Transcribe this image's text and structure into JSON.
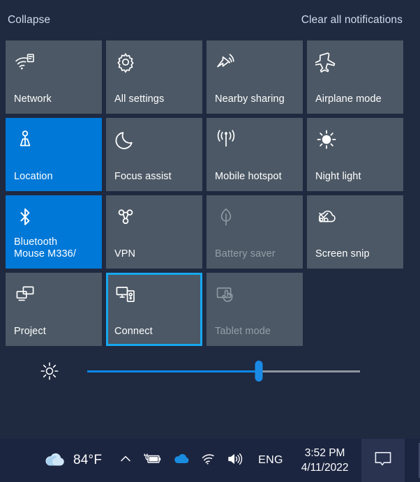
{
  "panel": {
    "background_color": "#1f2940",
    "tile_color": "#4c5865",
    "active_color": "#0078d7",
    "focus_color": "#16a8f0"
  },
  "header": {
    "collapse_label": "Collapse",
    "clear_all_label": "Clear all notifications"
  },
  "tiles": [
    {
      "label": "Network",
      "icon": "network-wifi-icon",
      "state": "normal"
    },
    {
      "label": "All settings",
      "icon": "gear-icon",
      "state": "normal"
    },
    {
      "label": "Nearby sharing",
      "icon": "nearby-sharing-icon",
      "state": "normal"
    },
    {
      "label": "Airplane mode",
      "icon": "airplane-icon",
      "state": "normal"
    },
    {
      "label": "Location",
      "icon": "location-icon",
      "state": "active"
    },
    {
      "label": "Focus assist",
      "icon": "moon-icon",
      "state": "normal"
    },
    {
      "label": "Mobile hotspot",
      "icon": "hotspot-icon",
      "state": "normal"
    },
    {
      "label": "Night light",
      "icon": "sun-icon",
      "state": "normal"
    },
    {
      "label": "Bluetooth\nMouse M336/",
      "icon": "bluetooth-icon",
      "state": "active"
    },
    {
      "label": "VPN",
      "icon": "vpn-icon",
      "state": "normal"
    },
    {
      "label": "Battery saver",
      "icon": "leaf-icon",
      "state": "disabled"
    },
    {
      "label": "Screen snip",
      "icon": "scissors-cloud-icon",
      "state": "normal"
    },
    {
      "label": "Project",
      "icon": "project-screen-icon",
      "state": "normal"
    },
    {
      "label": "Connect",
      "icon": "connect-device-icon",
      "state": "focused"
    },
    {
      "label": "Tablet mode",
      "icon": "tablet-touch-icon",
      "state": "disabled"
    }
  ],
  "brightness": {
    "icon": "brightness-sun-icon",
    "percent": 63
  },
  "taskbar": {
    "weather": {
      "icon": "weather-cloud-icon",
      "temperature": "84°F"
    },
    "tray_icons": [
      "chevron-up-icon",
      "battery-charging-icon",
      "onedrive-cloud-icon",
      "wifi-icon",
      "speaker-volume-icon"
    ],
    "language": "ENG",
    "time": "3:52 PM",
    "date": "4/11/2022",
    "action_center_icon": "notification-bubble-icon"
  }
}
